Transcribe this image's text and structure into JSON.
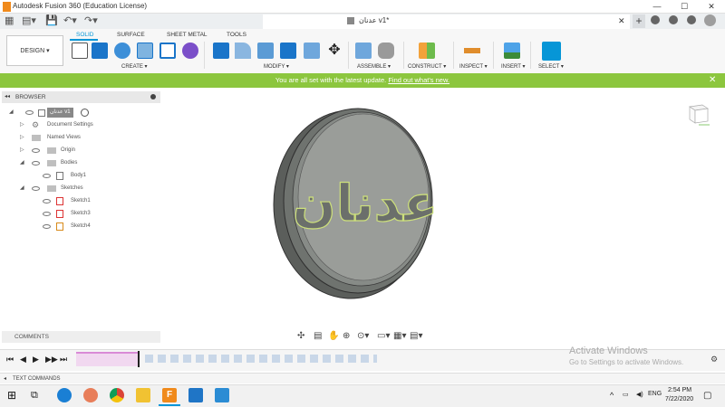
{
  "window": {
    "title": "Autodesk Fusion 360 (Education License)",
    "min": "—",
    "max": "☐",
    "close": "✕"
  },
  "doc_tab": {
    "title": "عدنان v1*",
    "close": "✕",
    "add": "+"
  },
  "workspace": {
    "label": "DESIGN ▾"
  },
  "ribbon_tabs": [
    "SOLID",
    "SURFACE",
    "SHEET METAL",
    "TOOLS"
  ],
  "groups": {
    "create": "CREATE ▾",
    "modify": "MODIFY ▾",
    "assemble": "ASSEMBLE ▾",
    "construct": "CONSTRUCT ▾",
    "inspect": "INSPECT ▾",
    "insert": "INSERT ▾",
    "select": "SELECT ▾"
  },
  "banner": {
    "text": "You are all set with the latest update.",
    "link": "Find out what's new.",
    "close": "✕"
  },
  "browser": {
    "title": "BROWSER",
    "root": "عدنان v1",
    "items": [
      {
        "label": "Document Settings"
      },
      {
        "label": "Named Views"
      },
      {
        "label": "Origin"
      },
      {
        "label": "Bodies"
      },
      {
        "label": "Body1"
      },
      {
        "label": "Sketches"
      },
      {
        "label": "Sketch1"
      },
      {
        "label": "Sketch3"
      },
      {
        "label": "Sketch4"
      }
    ]
  },
  "model": {
    "engraving": "عدنان"
  },
  "comments": {
    "label": "COMMENTS"
  },
  "activation": {
    "line1": "Activate Windows",
    "line2": "Go to Settings to activate Windows."
  },
  "text_commands": "TEXT COMMANDS",
  "tray": {
    "lang": "ENG",
    "time": "2:54 PM",
    "date": "7/22/2020"
  },
  "colors": {
    "accent": "#0696d7",
    "banner": "#8cc63e",
    "fusion_orange": "#f08a1c"
  },
  "icons": [
    "fusion-icon",
    "grid-icon",
    "save-icon",
    "undo-icon",
    "redo-icon",
    "close-icon",
    "help-icon",
    "windows-start-icon",
    "search-icon",
    "chrome-icon",
    "edge-icon",
    "file-explorer-icon",
    "vscode-icon",
    "photos-icon"
  ]
}
